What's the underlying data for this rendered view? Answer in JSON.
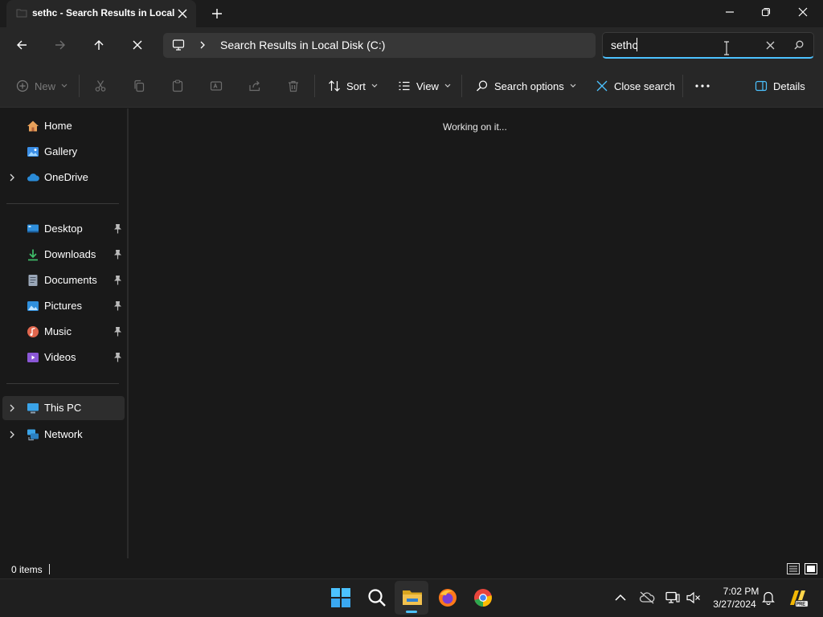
{
  "window": {
    "tab_title": "sethc - Search Results in Local",
    "icons": [
      "folder-icon",
      "close-icon",
      "new-tab-icon",
      "minimize-icon",
      "restore-icon",
      "close-window-icon"
    ]
  },
  "address_bar": {
    "path": "Search Results in Local Disk (C:)",
    "icons": [
      "back-arrow-icon",
      "forward-arrow-icon",
      "up-arrow-icon",
      "stop-icon",
      "computer-icon",
      "chevron-right-icon"
    ]
  },
  "search": {
    "value": "sethc",
    "icons": [
      "clear-search-icon",
      "search-icon"
    ]
  },
  "command_bar": {
    "new_label": "New",
    "sort_label": "Sort",
    "view_label": "View",
    "search_options_label": "Search options",
    "close_search_label": "Close search",
    "details_label": "Details"
  },
  "nav": {
    "home": "Home",
    "gallery": "Gallery",
    "onedrive": "OneDrive",
    "desktop": "Desktop",
    "downloads": "Downloads",
    "documents": "Documents",
    "pictures": "Pictures",
    "music": "Music",
    "videos": "Videos",
    "this_pc": "This PC",
    "network": "Network"
  },
  "content": {
    "status_message": "Working on it..."
  },
  "status_bar": {
    "items": "0 items"
  },
  "taskbar": {
    "time": "7:02 PM",
    "date": "3/27/2024",
    "apps": [
      "windows-start-icon",
      "search-icon",
      "file-explorer-icon",
      "firefox-icon",
      "chrome-icon"
    ]
  },
  "colors": {
    "accent": "#4cc2ff",
    "window_bg": "#191919",
    "chrome_bg": "#272727",
    "folder_yellow": "#f2c14e"
  }
}
